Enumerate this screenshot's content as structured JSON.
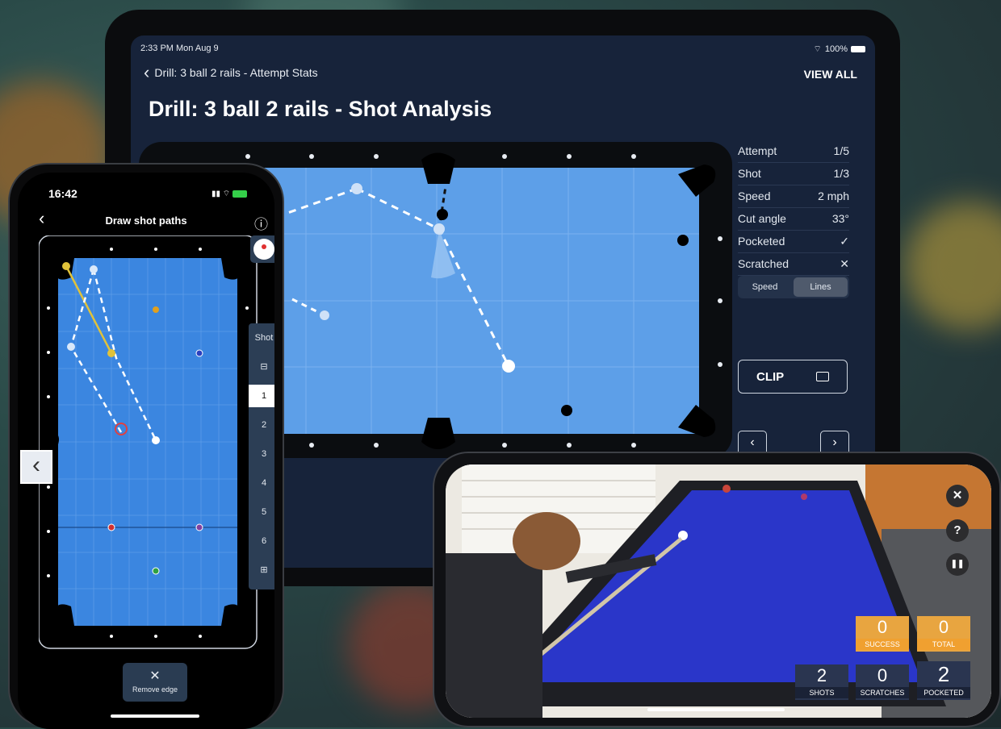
{
  "colors": {
    "accent": "#5d9fe8",
    "table_felt": "#3b86e0",
    "cloth_blue": "#2a36c9",
    "orange": "#f0a030"
  },
  "tablet": {
    "status_time": "2:33 PM  Mon Aug 9",
    "status_battery": "100%",
    "back_label": "Drill: 3 ball 2 rails - Attempt Stats",
    "view_all": "VIEW ALL",
    "title": "Drill: 3 ball 2 rails - Shot Analysis",
    "stats": [
      {
        "label": "Attempt",
        "value": "1/5"
      },
      {
        "label": "Shot",
        "value": "1/3"
      },
      {
        "label": "Speed",
        "value": "2 mph"
      },
      {
        "label": "Cut angle",
        "value": "33°"
      },
      {
        "label": "Pocketed",
        "value": "✓"
      },
      {
        "label": "Scratched",
        "value": "✕"
      }
    ],
    "segment": [
      "Speed",
      "Lines"
    ],
    "clip_label": "CLIP",
    "prev": "‹",
    "next": "›"
  },
  "phone": {
    "time": "16:42",
    "title": "Draw shot paths",
    "shot_label": "Shot",
    "shot_numbers": [
      "1",
      "2",
      "3",
      "4",
      "5",
      "6"
    ],
    "minus": "⊟",
    "plus": "⊞",
    "remove_icon": "✕",
    "remove_label": "Remove edge",
    "back": "‹",
    "info": "ⓘ",
    "side_back": "‹"
  },
  "landscape": {
    "close": "✕",
    "help": "?",
    "pause": "❚❚",
    "tiles_top": [
      {
        "value": "0",
        "label": "SUCCESS"
      },
      {
        "value": "0",
        "label": "TOTAL"
      }
    ],
    "tiles_bottom": [
      {
        "value": "2",
        "label": "SHOTS"
      },
      {
        "value": "0",
        "label": "SCRATCHES"
      },
      {
        "value": "2",
        "label": "POCKETED"
      }
    ]
  }
}
